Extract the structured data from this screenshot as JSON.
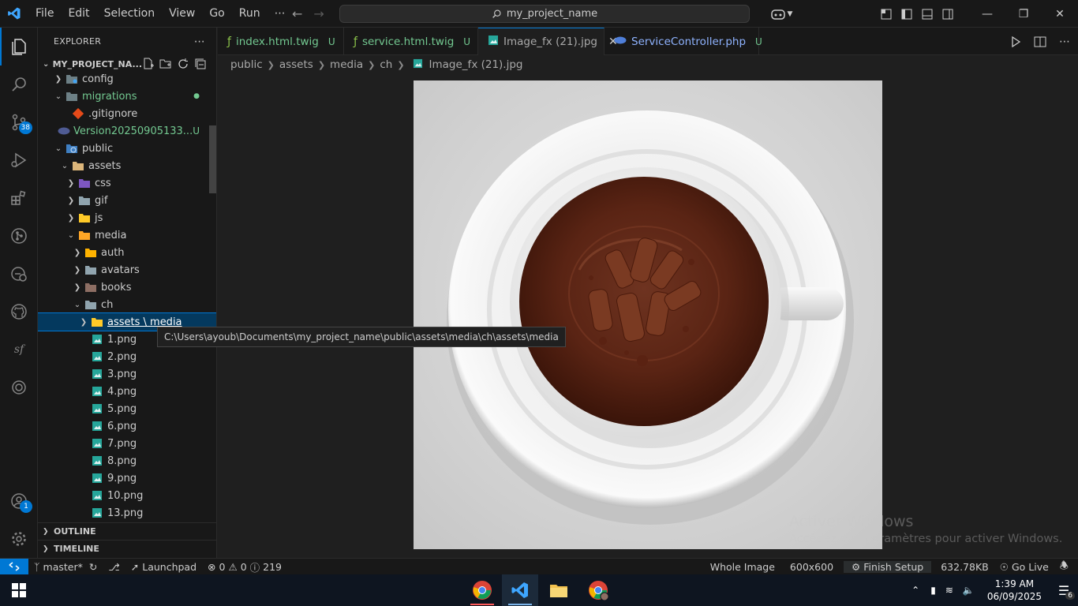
{
  "titlebar": {
    "menu": [
      "File",
      "Edit",
      "Selection",
      "View",
      "Go",
      "Run",
      "⋯"
    ],
    "search_text": "my_project_name"
  },
  "activity": {
    "scm_badge": "38",
    "account_badge": "1"
  },
  "sidebar": {
    "title": "EXPLORER",
    "project": "MY_PROJECT_NA...",
    "rows": [
      {
        "label": "config",
        "git": ""
      },
      {
        "label": "migrations",
        "git": "●"
      },
      {
        "label": ".gitignore",
        "git": ""
      },
      {
        "label": "Version20250905133...",
        "git": "U"
      },
      {
        "label": "public",
        "git": ""
      },
      {
        "label": "assets",
        "git": ""
      },
      {
        "label": "css",
        "git": ""
      },
      {
        "label": "gif",
        "git": ""
      },
      {
        "label": "js",
        "git": ""
      },
      {
        "label": "media",
        "git": ""
      },
      {
        "label": "auth",
        "git": ""
      },
      {
        "label": "avatars",
        "git": ""
      },
      {
        "label": "books",
        "git": ""
      },
      {
        "label": "ch",
        "git": ""
      },
      {
        "label": "assets \\ media",
        "git": ""
      },
      {
        "label": "1.png",
        "git": ""
      },
      {
        "label": "2.png",
        "git": ""
      },
      {
        "label": "3.png",
        "git": ""
      },
      {
        "label": "4.png",
        "git": ""
      },
      {
        "label": "5.png",
        "git": ""
      },
      {
        "label": "6.png",
        "git": ""
      },
      {
        "label": "7.png",
        "git": ""
      },
      {
        "label": "8.png",
        "git": ""
      },
      {
        "label": "9.png",
        "git": ""
      },
      {
        "label": "10.png",
        "git": ""
      },
      {
        "label": "13.png",
        "git": ""
      }
    ],
    "outline": "OUTLINE",
    "timeline": "TIMELINE"
  },
  "tooltip": "C:\\Users\\ayoub\\Documents\\my_project_name\\public\\assets\\media\\ch\\assets\\media",
  "tabs": [
    {
      "label": "index.html.twig",
      "status": "U"
    },
    {
      "label": "service.html.twig",
      "status": "U"
    },
    {
      "label": "Image_fx (21).jpg",
      "status": ""
    },
    {
      "label": "ServiceController.php",
      "status": "U"
    }
  ],
  "breadcrumb": [
    "public",
    "assets",
    "media",
    "ch",
    "Image_fx (21).jpg"
  ],
  "watermark": {
    "line1": "Activer Windows",
    "line2": "Accédez aux paramètres pour activer Windows."
  },
  "statusbar": {
    "branch": "master*",
    "launchpad": "Launchpad",
    "errors": "0",
    "warnings": "0",
    "info": "219",
    "whole_image": "Whole Image",
    "dimensions": "600x600",
    "finish_setup": "Finish Setup",
    "size": "632.78KB",
    "go_live": "Go Live"
  },
  "taskbar": {
    "time": "1:39 AM",
    "date": "06/09/2025",
    "notif": "6"
  },
  "colors": {
    "accent": "#0078d4",
    "git_untracked": "#73c991",
    "folder": "#dcb67a"
  }
}
